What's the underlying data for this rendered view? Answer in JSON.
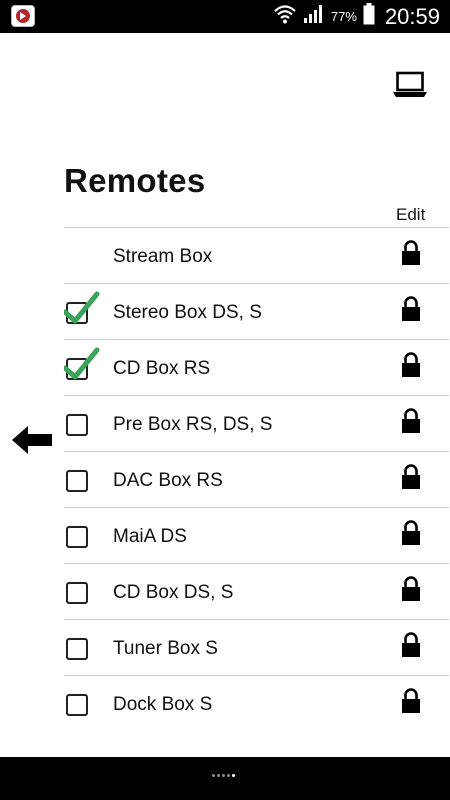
{
  "status_bar": {
    "battery_percent": "77%",
    "time": "20:59",
    "icons": [
      "app-icon",
      "wifi-icon",
      "signal-icon",
      "battery-icon"
    ]
  },
  "header": {
    "title": "Remotes",
    "edit_label": "Edit",
    "laptop_icon": "laptop-icon"
  },
  "remotes": [
    {
      "label": "Stream Box",
      "checkbox": "none"
    },
    {
      "label": "Stereo Box DS, S",
      "checkbox": "checked"
    },
    {
      "label": "CD Box RS",
      "checkbox": "checked"
    },
    {
      "label": "Pre Box RS, DS, S",
      "checkbox": "unchecked"
    },
    {
      "label": "DAC Box RS",
      "checkbox": "unchecked"
    },
    {
      "label": "MaiA DS",
      "checkbox": "unchecked"
    },
    {
      "label": "CD Box DS, S",
      "checkbox": "unchecked"
    },
    {
      "label": "Tuner Box S",
      "checkbox": "unchecked"
    },
    {
      "label": "Dock Box S",
      "checkbox": "unchecked"
    }
  ],
  "colors": {
    "check_green": "#3aa35a",
    "status_bar": "#000000",
    "nav_bar": "#000000"
  },
  "nav": {
    "page_dots": 5,
    "active_dot": 5
  }
}
